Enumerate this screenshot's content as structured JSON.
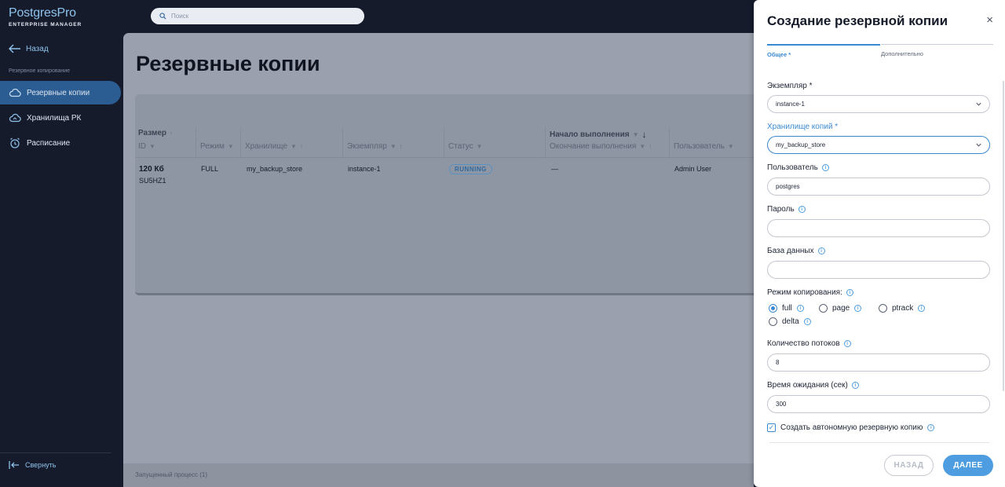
{
  "sidebar": {
    "logo_name": "PostgresPro",
    "logo_sub": "ENTERPRISE MANAGER",
    "back_label": "Назад",
    "section_label": "Резервное копирование",
    "items": [
      {
        "label": "Резервные копии",
        "icon": "cloud-icon",
        "active": true
      },
      {
        "label": "Хранилища РК",
        "icon": "storage-cloud-icon",
        "active": false
      },
      {
        "label": "Расписание",
        "icon": "alarm-clock-icon",
        "active": false
      }
    ],
    "collapse_label": "Свернуть"
  },
  "search": {
    "placeholder": "Поиск"
  },
  "main": {
    "title": "Резервные копии",
    "table": {
      "headers": {
        "size": "Размер",
        "id": "ID",
        "mode": "Режим",
        "storage": "Хранилище",
        "instance": "Экземпляр",
        "status": "Статус",
        "start": "Начало выполнения",
        "end": "Окончание выполнения",
        "user": "Пользователь"
      },
      "rows": [
        {
          "size": "120 Кб",
          "id": "SU5HZ1",
          "mode": "FULL",
          "storage": "my_backup_store",
          "instance": "instance-1",
          "status": "RUNNING",
          "end": "—",
          "user": "Admin User"
        }
      ]
    },
    "footer": "Запущенный процесс (1)"
  },
  "panel": {
    "title": "Создание резервной копии",
    "close": "×",
    "tabs": [
      {
        "label": "Общее *",
        "active": true
      },
      {
        "label": "Дополнительно",
        "active": false
      }
    ],
    "fields": {
      "instance": {
        "label": "Экземпляр *",
        "value": "instance-1"
      },
      "storage": {
        "label": "Хранилище копий *",
        "value": "my_backup_store"
      },
      "user": {
        "label": "Пользователь",
        "value": "postgres"
      },
      "password": {
        "label": "Пароль",
        "value": ""
      },
      "database": {
        "label": "База данных",
        "value": ""
      },
      "mode": {
        "label": "Режим копирования:",
        "options": [
          "full",
          "page",
          "ptrack",
          "delta"
        ],
        "selected": "full"
      },
      "threads": {
        "label": "Количество потоков",
        "value": "8"
      },
      "timeout": {
        "label": "Время ожидания (сек)",
        "value": "300"
      },
      "standalone": {
        "label": "Создать автономную резервную копию",
        "checked": true
      }
    },
    "buttons": {
      "back": "НАЗАД",
      "next": "ДАЛЕЕ"
    }
  },
  "colors": {
    "accent": "#3b8ad1",
    "sidebar_bg": "#161b2c",
    "active_nav": "#2b5d93",
    "primary_button": "#4d9de0"
  }
}
